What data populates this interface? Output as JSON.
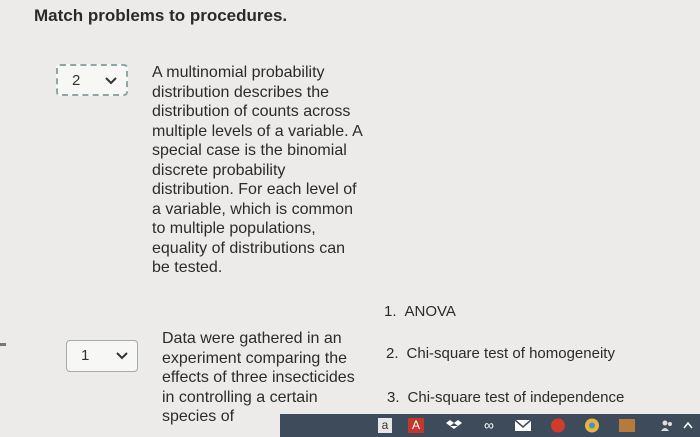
{
  "title": "Match problems to procedures.",
  "questions": [
    {
      "selected": "2",
      "text": "A multinomial probability distribution describes the distribution of counts across multiple levels of a variable. A special case is the binomial discrete probability distribution. For each level of a variable, which is common to multiple populations, equality of distributions can be tested."
    },
    {
      "selected": "1",
      "text": "Data were gathered in an experiment comparing the effects of three insecticides in controlling a certain species of"
    }
  ],
  "options": [
    {
      "num": "1.",
      "label": "ANOVA"
    },
    {
      "num": "2.",
      "label": "Chi-square test of homogeneity"
    },
    {
      "num": "3.",
      "label": "Chi-square test of independence"
    }
  ],
  "taskbar": {
    "icons": [
      "a",
      "A",
      "dropbox-icon",
      "∞",
      "mail-icon",
      "acrobat-icon",
      "chrome-icon",
      "photos-icon",
      "people-icon",
      "chevron-up-icon"
    ]
  }
}
